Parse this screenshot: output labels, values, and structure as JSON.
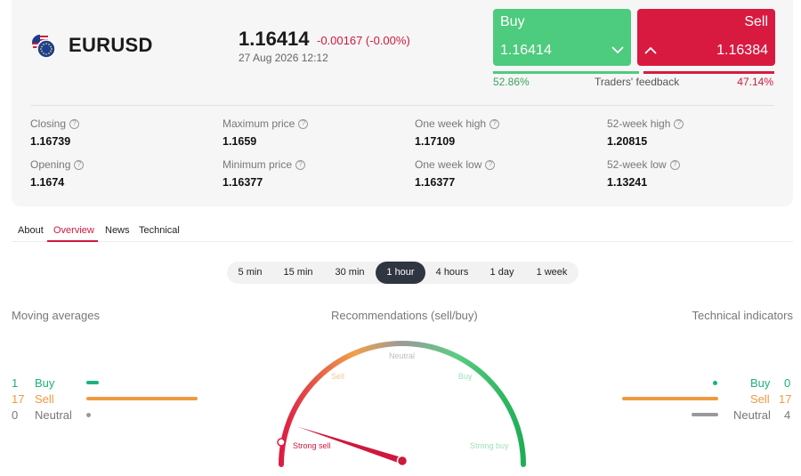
{
  "instrument": {
    "symbol": "EURUSD",
    "price": "1.16414",
    "change": "-0.00167 (-0.00%)",
    "datetime": "27 Aug 2026 12:12"
  },
  "trade": {
    "buy": {
      "label": "Buy",
      "value": "1.16414"
    },
    "sell": {
      "label": "Sell",
      "value": "1.16384"
    }
  },
  "feedback": {
    "label": "Traders' feedback",
    "buy_pct": "52.86%",
    "sell_pct": "47.14%",
    "buy_share": 0.5286
  },
  "stats": [
    {
      "label": "Closing",
      "value": "1.16739"
    },
    {
      "label": "Maximum price",
      "value": "1.1659"
    },
    {
      "label": "One week high",
      "value": "1.17109"
    },
    {
      "label": "52-week high",
      "value": "1.20815"
    },
    {
      "label": "Opening",
      "value": "1.1674"
    },
    {
      "label": "Minimum price",
      "value": "1.16377"
    },
    {
      "label": "One week low",
      "value": "1.16377"
    },
    {
      "label": "52-week low",
      "value": "1.13241"
    }
  ],
  "tabs": [
    "About",
    "Overview",
    "News",
    "Technical"
  ],
  "active_tab": "Overview",
  "periods": [
    "5 min",
    "15 min",
    "30 min",
    "1 hour",
    "4 hours",
    "1 day",
    "1 week"
  ],
  "active_period": "1 hour",
  "moving_averages": {
    "title": "Moving averages",
    "buy": {
      "count": "1",
      "label": "Buy"
    },
    "sell": {
      "count": "17",
      "label": "Sell"
    },
    "neutral": {
      "count": "0",
      "label": "Neutral"
    }
  },
  "recommendations": {
    "title": "Recommendations (sell/buy)",
    "labels": {
      "strong_sell": "Strong sell",
      "sell": "Sell",
      "neutral": "Neutral",
      "buy": "Buy",
      "strong_buy": "Strong buy"
    },
    "needle_level": 0.06
  },
  "technical_indicators": {
    "title": "Technical indicators",
    "buy": {
      "count": "0",
      "label": "Buy"
    },
    "sell": {
      "count": "17",
      "label": "Sell"
    },
    "neutral": {
      "count": "4",
      "label": "Neutral"
    }
  },
  "colors": {
    "buy": "#4dcb7e",
    "sell": "#d91a40",
    "green_text": "#1bb37a",
    "orange": "#f09a3e",
    "neutral": "#9a9a9a"
  }
}
